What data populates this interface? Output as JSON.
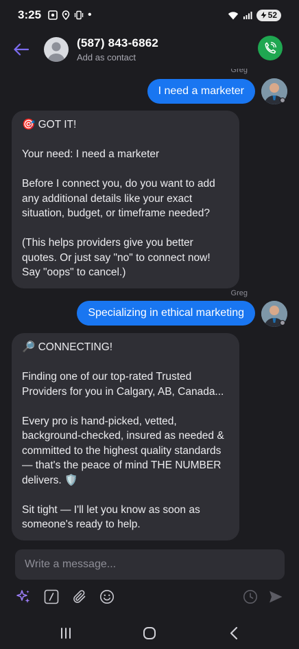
{
  "status": {
    "time": "3:25",
    "battery": "52"
  },
  "header": {
    "contact_name": "(587) 843-6862",
    "contact_sub": "Add as contact"
  },
  "messages": [
    {
      "direction": "out",
      "sender": "Greg",
      "text": "I need a marketer"
    },
    {
      "direction": "in",
      "paragraphs": [
        "🎯 GOT IT!",
        "Your need: I need a marketer",
        "Before I connect you, do you want to add any additional details like your exact situation, budget, or timeframe needed?",
        "(This helps providers give you better quotes. Or just say \"no\" to connect now! Say \"oops\" to cancel.)"
      ]
    },
    {
      "direction": "out",
      "sender": "Greg",
      "text": "Specializing in ethical marketing"
    },
    {
      "direction": "in",
      "paragraphs": [
        "🔎 CONNECTING!",
        "Finding one of our top-rated Trusted Providers for you in Calgary, AB, Canada...",
        "Every pro is hand-picked, vetted, background-checked, insured as needed & committed to the highest quality standards — that's the peace of mind THE NUMBER delivers. 🛡️",
        "Sit tight — I'll let you know as soon as someone's ready to help."
      ]
    }
  ],
  "composer": {
    "placeholder": "Write a message..."
  },
  "colors": {
    "accent": "#1976f1",
    "call": "#1fa751",
    "back_arrow": "#7c6cf0",
    "sparkle": "#9b7df7"
  },
  "icons": {
    "back": "arrow-left-icon",
    "call": "phone-icon",
    "ai": "sparkle-icon",
    "command": "slash-command-icon",
    "attach": "paperclip-icon",
    "emoji": "emoji-icon",
    "schedule": "clock-icon",
    "send": "send-icon"
  }
}
